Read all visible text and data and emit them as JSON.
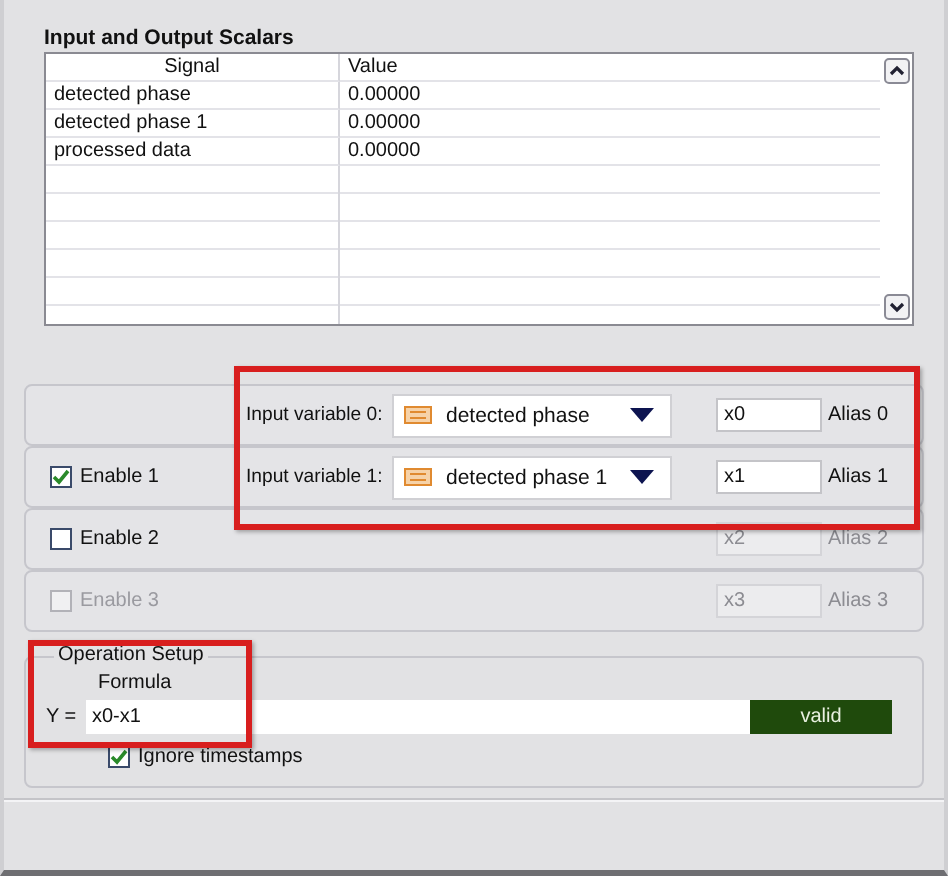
{
  "section_title": "Input and Output Scalars",
  "table": {
    "columns": [
      "Signal",
      "Value"
    ],
    "rows": [
      [
        "detected phase",
        "0.00000"
      ],
      [
        "detected phase 1",
        "0.00000"
      ],
      [
        "processed data",
        "0.00000"
      ]
    ]
  },
  "variables": [
    {
      "kind": "input",
      "label": "Input variable 0:",
      "signal": "detected phase",
      "alias": {
        "value": "x0",
        "label": "Alias 0",
        "disabled": false
      }
    },
    {
      "kind": "input",
      "enable": {
        "label": "Enable 1",
        "checked": true,
        "disabled": false
      },
      "label": "Input variable 1:",
      "signal": "detected phase 1",
      "alias": {
        "value": "x1",
        "label": "Alias 1",
        "disabled": false
      }
    },
    {
      "kind": "alias_only",
      "enable": {
        "label": "Enable 2",
        "checked": false,
        "disabled": false
      },
      "alias": {
        "value": "x2",
        "label": "Alias 2",
        "disabled": true
      }
    },
    {
      "kind": "alias_only",
      "enable": {
        "label": "Enable 3",
        "checked": false,
        "disabled": true
      },
      "alias": {
        "value": "x3",
        "label": "Alias 3",
        "disabled": true
      }
    }
  ],
  "operation_setup": {
    "title": "Operation Setup",
    "formula_label": "Formula",
    "prefix": "Y =",
    "formula": "x0-x1",
    "status": "valid",
    "ignore_timestamps": {
      "label": "Ignore timestamps",
      "checked": true
    }
  },
  "highlights": {
    "input_variables": true,
    "operation_setup": true
  }
}
